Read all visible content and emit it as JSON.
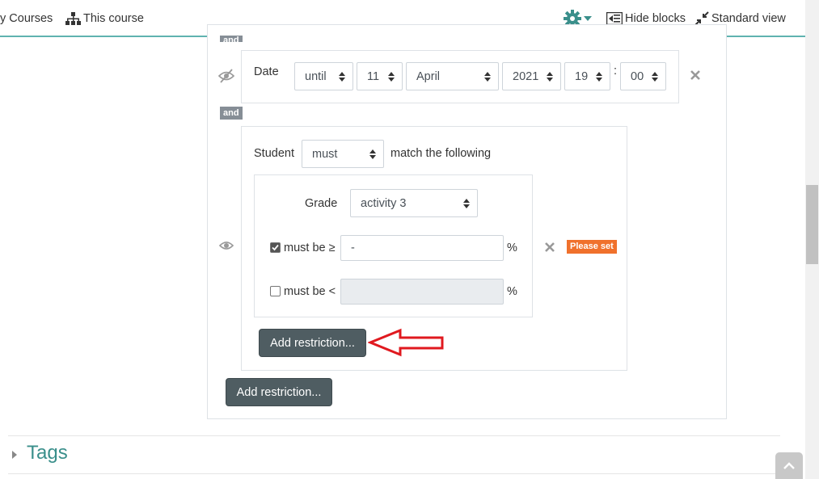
{
  "topbar": {
    "my_courses": "y Courses",
    "this_course": "This course",
    "hide_blocks": "Hide blocks",
    "standard_view": "Standard view"
  },
  "badges": {
    "and_top": "and",
    "and": "and"
  },
  "date_condition": {
    "label": "Date",
    "direction": "until",
    "day": "11",
    "month": "April",
    "year": "2021",
    "hour": "19",
    "colon": ":",
    "minute": "00"
  },
  "restriction_set": {
    "student_label": "Student",
    "must": "must",
    "match_text": "match the following",
    "grade": {
      "label": "Grade",
      "activity": "activity 3",
      "min_label": "must be ≥",
      "min_checked": true,
      "min_value": "-",
      "max_label": "must be <",
      "max_checked": false,
      "max_value": "",
      "percent": "%",
      "warning": "Please set"
    },
    "add_restriction_inner": "Add restriction..."
  },
  "add_restriction_outer": "Add restriction...",
  "tags": {
    "title": "Tags"
  },
  "colors": {
    "accent": "#3a8f8b",
    "button": "#4f5d62",
    "warning": "#f0712c",
    "arrow": "#e0191f"
  }
}
